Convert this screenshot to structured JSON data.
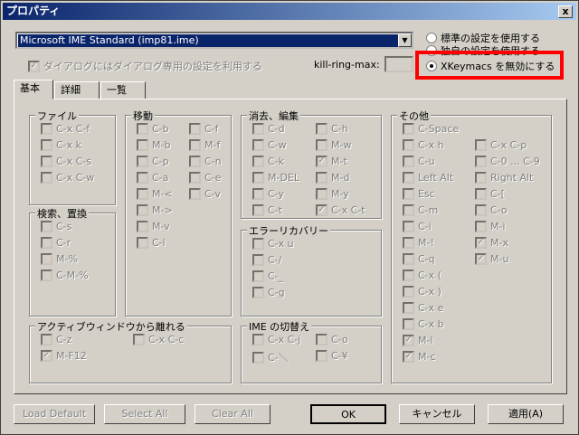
{
  "window": {
    "title": "プロパティ",
    "close": "x"
  },
  "ime_combo": {
    "value": "Microsoft IME Standard (imp81.ime)",
    "arrow": "▼"
  },
  "dialog_chk": {
    "label": "ダイアログにはダイアログ専用の設定を利用する",
    "mark": "✓"
  },
  "killring": {
    "label": "kill-ring-max:"
  },
  "radios": [
    "標準の設定を使用する",
    "独自の設定を使用する",
    "XKeymacs を無効にする"
  ],
  "tabs": [
    "基本",
    "詳細",
    "一覧"
  ],
  "groups": {
    "file": {
      "title": "ファイル",
      "items": [
        "C-x C-f",
        "C-x k",
        "C-x C-s",
        "C-x C-w"
      ]
    },
    "search": {
      "title": "検索、置換",
      "items": [
        "C-s",
        "C-r",
        "M-%",
        "C-M-%"
      ]
    },
    "move": {
      "title": "移動",
      "col1": [
        "C-b",
        "M-b",
        "C-p",
        "C-a",
        "M-<",
        "M->",
        "M-v",
        "C-l"
      ],
      "col2": [
        "C-f",
        "M-f",
        "C-n",
        "C-e",
        "C-v"
      ]
    },
    "edit": {
      "title": "消去、編集",
      "col1": [
        "C-d",
        "C-w",
        "C-k",
        "M-DEL",
        "C-y",
        "C-t"
      ],
      "col2": [
        "C-h",
        "M-w",
        "M-t",
        "M-d",
        "M-y",
        "C-x C-t"
      ]
    },
    "error": {
      "title": "エラーリカバリー",
      "items": [
        "C-x u",
        "C-/",
        "C-_",
        "C-g"
      ]
    },
    "active": {
      "title": "アクティブウィンドウから離れる",
      "col1": [
        "C-z",
        "M-F12"
      ],
      "col2": [
        "C-x C-c"
      ]
    },
    "imesw": {
      "title": "IME の切替え",
      "col1": [
        "C-x C-j",
        "C-＼"
      ],
      "col2": [
        "C-o",
        "C-¥"
      ]
    },
    "other": {
      "title": "その他",
      "col1": [
        "C-Space",
        "C-x h",
        "C-u",
        "Left Alt",
        "Esc",
        "C-m",
        "C-i",
        "M-!",
        "C-q",
        "C-x (",
        "C-x )",
        "C-x e",
        "C-x b",
        "M-l",
        "M-c"
      ],
      "col2": [
        "C-x C-p",
        "C-0 ... C-9",
        "Right Alt",
        "C-[",
        "C-o",
        "M-i",
        "M-x",
        "M-u"
      ]
    }
  },
  "buttons": {
    "load": "Load Default",
    "select": "Select All",
    "clear": "Clear All",
    "ok": "OK",
    "cancel": "キャンセル",
    "apply": "適用(A)"
  }
}
